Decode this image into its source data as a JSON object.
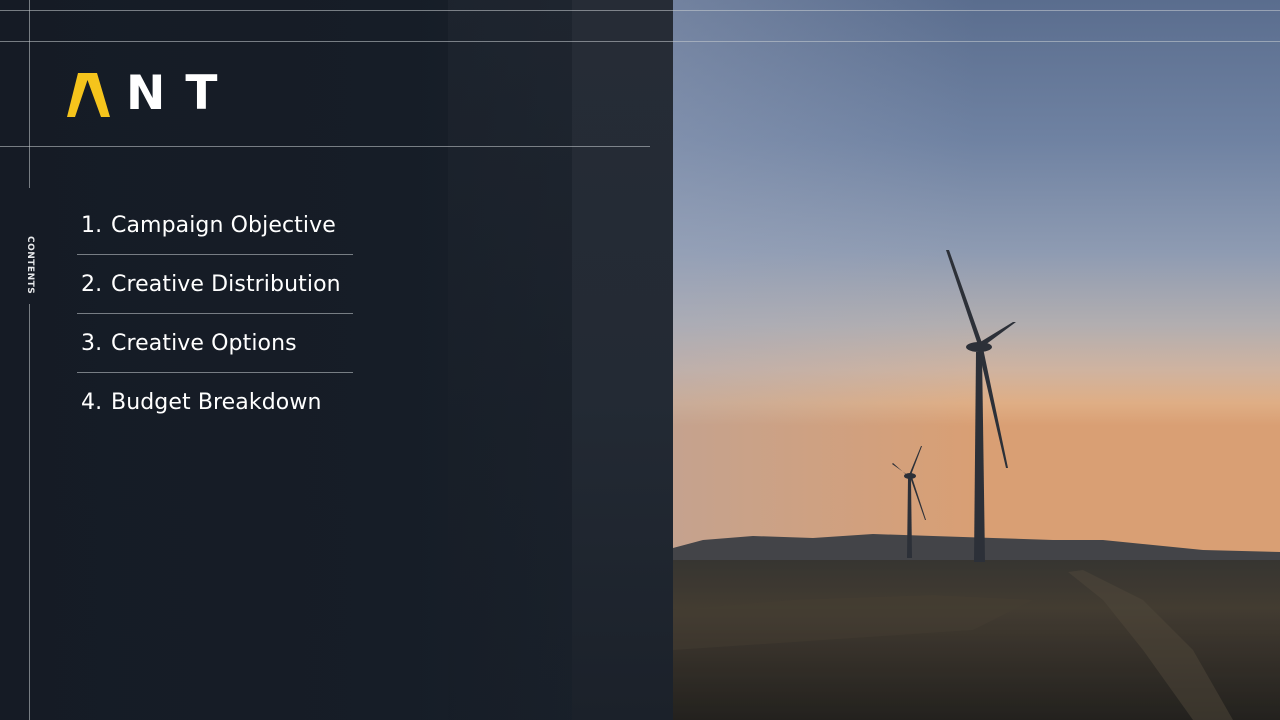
{
  "brand": {
    "logo_text": "NT",
    "logo_full": "ANT",
    "accent_color": "#f5c41c"
  },
  "section_label": "CONTENTS",
  "toc": [
    {
      "number": "1.",
      "label": "Campaign Objective"
    },
    {
      "number": "2.",
      "label": "Creative Distribution"
    },
    {
      "number": "3.",
      "label": "Creative Options"
    },
    {
      "number": "4.",
      "label": "Budget Breakdown"
    }
  ],
  "colors": {
    "panel_bg": "#151b25",
    "text": "#ffffff",
    "rule": "#c8cdd2"
  },
  "photo": {
    "subject": "wind-turbines-at-sunset"
  }
}
